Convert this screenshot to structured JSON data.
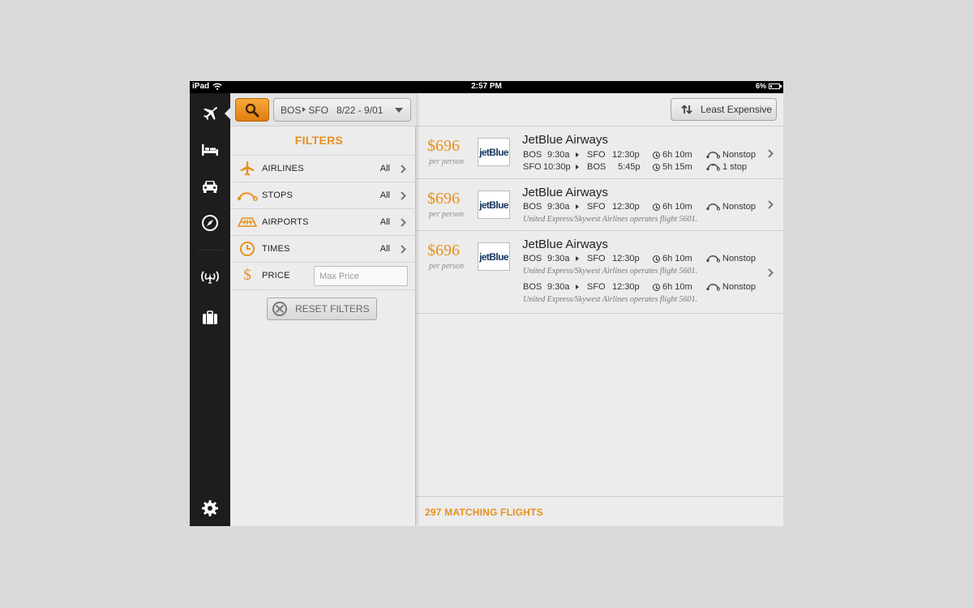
{
  "status_bar": {
    "device": "iPad",
    "time": "2:57 PM",
    "battery": "6%"
  },
  "rail": {
    "items": [
      {
        "icon": "plane-icon"
      },
      {
        "icon": "hotel-bed-icon"
      },
      {
        "icon": "car-icon"
      },
      {
        "icon": "compass-icon"
      },
      {
        "icon": "airport-tower-icon"
      },
      {
        "icon": "briefcase-icon"
      },
      {
        "icon": "gear-icon"
      }
    ]
  },
  "search": {
    "origin": "BOS",
    "destination": "SFO",
    "dates": "8/22 - 9/01"
  },
  "filters": {
    "title": "FILTERS",
    "rows": [
      {
        "label": "AIRLINES",
        "value": "All",
        "icon": "plane-icon"
      },
      {
        "label": "STOPS",
        "value": "All",
        "icon": "stops-arc-icon"
      },
      {
        "label": "AIRPORTS",
        "value": "All",
        "icon": "runway-icon"
      },
      {
        "label": "TIMES",
        "value": "All",
        "icon": "clock-icon"
      }
    ],
    "price": {
      "label": "PRICE",
      "placeholder": "Max Price",
      "symbol": "$"
    },
    "reset_label": "RESET FILTERS"
  },
  "sort": {
    "label": "Least Expensive"
  },
  "flights": [
    {
      "price": "$696",
      "per": "per person",
      "logo": "jetBlue",
      "airline": "JetBlue Airways",
      "legs": [
        {
          "from": "BOS",
          "dep": "9:30a",
          "to": "SFO",
          "arr": "12:30p",
          "duration": "6h 10m",
          "stops": "Nonstop"
        },
        {
          "from": "SFO",
          "dep": "10:30p",
          "to": "BOS",
          "arr": "5:45p",
          "duration": "5h 15m",
          "stops": "1 stop"
        }
      ]
    },
    {
      "price": "$696",
      "per": "per person",
      "logo": "jetBlue",
      "airline": "JetBlue Airways",
      "legs": [
        {
          "from": "BOS",
          "dep": "9:30a",
          "to": "SFO",
          "arr": "12:30p",
          "duration": "6h 10m",
          "stops": "Nonstop"
        }
      ],
      "operated": "United Express/Skywest Airlines operates flight 5601."
    },
    {
      "price": "$696",
      "per": "per person",
      "logo": "jetBlue",
      "airline": "JetBlue Airways",
      "legs": [
        {
          "from": "BOS",
          "dep": "9:30a",
          "to": "SFO",
          "arr": "12:30p",
          "duration": "6h 10m",
          "stops": "Nonstop",
          "operated": "United Express/Skywest Airlines operates flight 5601."
        },
        {
          "from": "BOS",
          "dep": "9:30a",
          "to": "SFO",
          "arr": "12:30p",
          "duration": "6h 10m",
          "stops": "Nonstop",
          "operated": "United Express/Skywest Airlines operates flight 5601."
        }
      ]
    }
  ],
  "footer": {
    "matching": "297 MATCHING FLIGHTS"
  },
  "colors": {
    "accent": "#e8901c",
    "rail": "#1d1d1d",
    "panel": "#ececec"
  }
}
